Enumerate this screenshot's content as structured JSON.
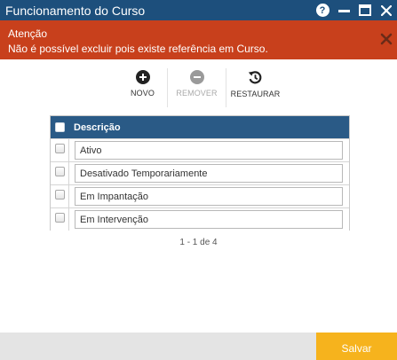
{
  "window": {
    "title": "Funcionamento do Curso",
    "help_label": "?"
  },
  "alert": {
    "title": "Atenção",
    "message": "Não é possível excluir pois existe referência em Curso."
  },
  "toolbar": {
    "novo_label": "NOVO",
    "remover_label": "REMOVER",
    "restaurar_label": "RESTAURAR"
  },
  "grid": {
    "column_header": "Descrição",
    "rows": [
      {
        "descricao": "Ativo"
      },
      {
        "descricao": "Desativado Temporariamente"
      },
      {
        "descricao": "Em Impantação"
      },
      {
        "descricao": "Em Intervenção"
      }
    ]
  },
  "pager": {
    "text": "1 - 1 de 4"
  },
  "footer": {
    "save_label": "Salvar"
  },
  "colors": {
    "titlebar": "#1d4f7c",
    "alert": "#c8401c",
    "grid_header": "#2a5a86",
    "save_button": "#f6b31d"
  }
}
